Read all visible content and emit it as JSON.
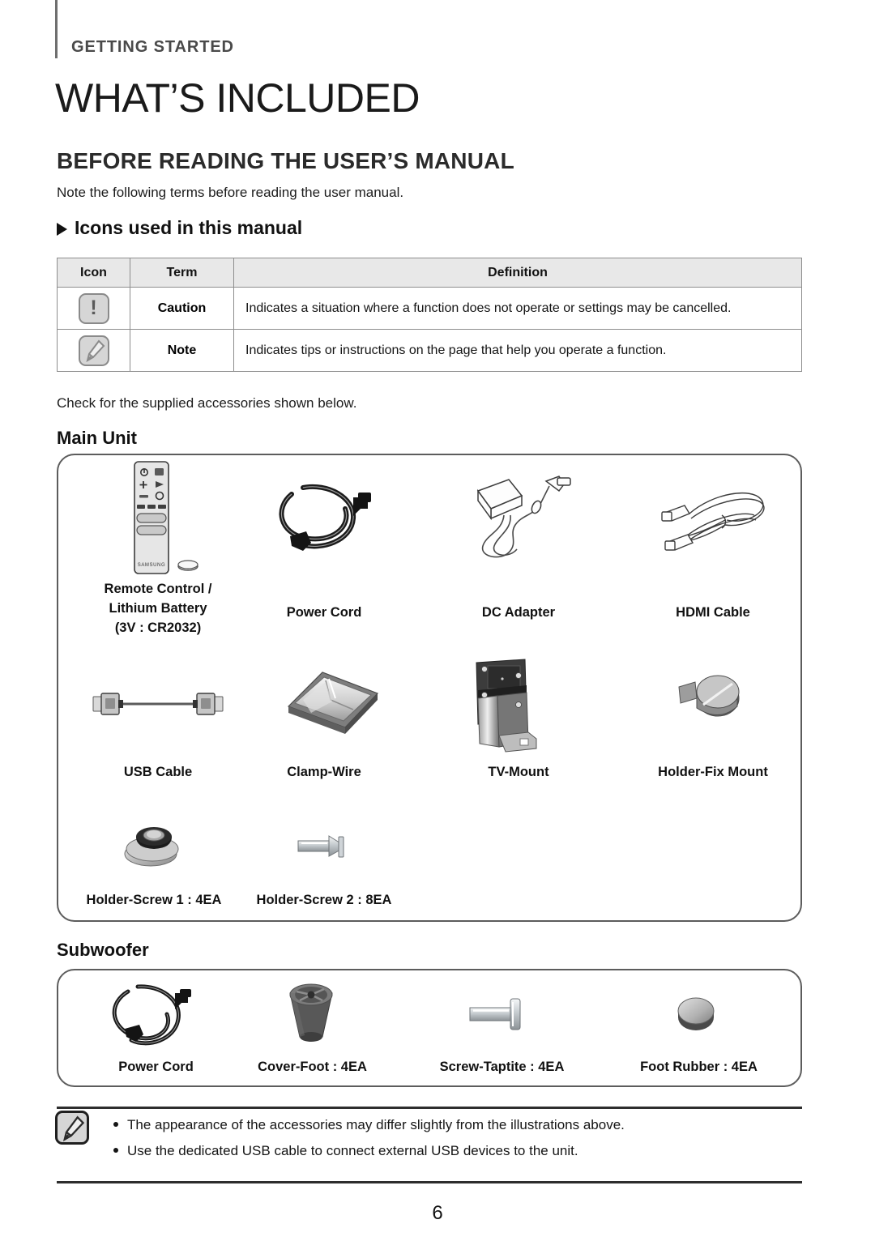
{
  "header": {
    "kicker": "GETTING STARTED",
    "chapter_title": "WHAT’S INCLUDED",
    "section_title": "BEFORE READING THE USER’S MANUAL",
    "section_note": "Note the following terms before reading the user manual.",
    "sub_heading": "Icons used in this manual"
  },
  "icon_table": {
    "columns": [
      "Icon",
      "Term",
      "Definition"
    ],
    "rows": [
      {
        "icon": "caution-icon",
        "term": "Caution",
        "definition": "Indicates a situation where a function does not operate or settings may be cancelled."
      },
      {
        "icon": "note-icon",
        "term": "Note",
        "definition": "Indicates tips or instructions on the page that help you operate a function."
      }
    ]
  },
  "accessories_intro": "Check for the supplied accessories shown below.",
  "main_unit": {
    "heading": "Main Unit",
    "items": [
      {
        "art": "remote-control",
        "label": "Remote Control /\nLithium Battery\n(3V : CR2032)"
      },
      {
        "art": "power-cord",
        "label": "Power Cord"
      },
      {
        "art": "dc-adapter",
        "label": "DC Adapter"
      },
      {
        "art": "hdmi-cable",
        "label": "HDMI Cable"
      },
      {
        "art": "usb-cable",
        "label": "USB Cable"
      },
      {
        "art": "clamp-wire",
        "label": "Clamp-Wire"
      },
      {
        "art": "tv-mount",
        "label": "TV-Mount"
      },
      {
        "art": "holder-fix-mount",
        "label": "Holder-Fix Mount"
      },
      {
        "art": "holder-screw-1",
        "label": "Holder-Screw 1 : 4EA"
      },
      {
        "art": "holder-screw-2",
        "label": "Holder-Screw 2 : 8EA"
      }
    ]
  },
  "subwoofer": {
    "heading": "Subwoofer",
    "items": [
      {
        "art": "sub-power-cord",
        "label": "Power Cord"
      },
      {
        "art": "cover-foot",
        "label": "Cover-Foot : 4EA"
      },
      {
        "art": "screw-taptite",
        "label": "Screw-Taptite : 4EA"
      },
      {
        "art": "foot-rubber",
        "label": "Foot Rubber : 4EA"
      }
    ]
  },
  "footer_notes": [
    "The appearance of the accessories may differ slightly from the illustrations above.",
    "Use the dedicated USB cable to connect external USB devices to the unit."
  ],
  "page_number": "6",
  "colors": {
    "rule": "#6f6f6f",
    "kicker_text": "#4a4a4a",
    "table_header_bg": "#e8e8e8",
    "table_border": "#8d8d8d",
    "box_border": "#5c5c5c"
  }
}
